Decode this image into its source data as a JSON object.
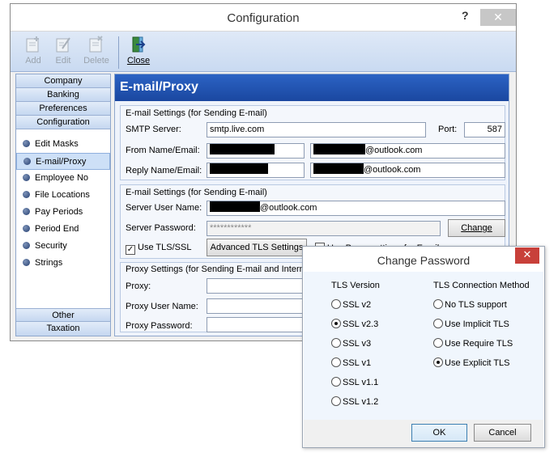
{
  "window": {
    "title": "Configuration",
    "help_label": "?",
    "close_label": "✕"
  },
  "toolbar": {
    "add_label": "Add",
    "edit_label": "Edit",
    "delete_label": "Delete",
    "close_label": "Close"
  },
  "nav": {
    "top_bars": [
      "Company",
      "Banking",
      "Preferences",
      "Configuration"
    ],
    "items": [
      "Edit Masks",
      "E-mail/Proxy",
      "Employee No",
      "File Locations",
      "Pay Periods",
      "Period End",
      "Security",
      "Strings"
    ],
    "selected": "E-mail/Proxy",
    "bottom_bars": [
      "Other",
      "Taxation"
    ]
  },
  "content": {
    "banner": "E-mail/Proxy",
    "group1": {
      "title": "E-mail Settings (for Sending E-mail)",
      "smtp_label": "SMTP Server:",
      "smtp_value": "smtp.live.com",
      "port_label": "Port:",
      "port_value": "587",
      "from_label": "From Name/Email:",
      "from_email_suffix": "@outlook.com",
      "reply_label": "Reply Name/Email:",
      "reply_email_suffix": "@outlook.com"
    },
    "group2": {
      "title": "E-mail Settings (for Sending E-mail)",
      "user_label": "Server User Name:",
      "user_suffix": "@outlook.com",
      "password_label": "Server Password:",
      "password_value": "************",
      "change_label": "Change",
      "tls_label": "Use TLS/SSL",
      "advanced_label": "Advanced TLS Settings",
      "use_proxy_label": "Use Proxy settings for Email"
    },
    "group3": {
      "title": "Proxy Settings (for Sending E-mail and Internet c",
      "proxy_label": "Proxy:",
      "proxy_user_label": "Proxy User Name:",
      "proxy_password_label": "Proxy Password:"
    }
  },
  "dialog": {
    "title": "Change Password",
    "close_label": "✕",
    "tls_version_header": "TLS Version",
    "tls_method_header": "TLS Connection Method",
    "versions": [
      "SSL v2",
      "SSL v2.3",
      "SSL v3",
      "SSL v1",
      "SSL v1.1",
      "SSL v1.2"
    ],
    "selected_version": "SSL v2.3",
    "methods": [
      "No TLS support",
      "Use Implicit TLS",
      "Use Require TLS",
      "Use Explicit TLS"
    ],
    "selected_method": "Use Explicit TLS",
    "ok_label": "OK",
    "cancel_label": "Cancel"
  }
}
